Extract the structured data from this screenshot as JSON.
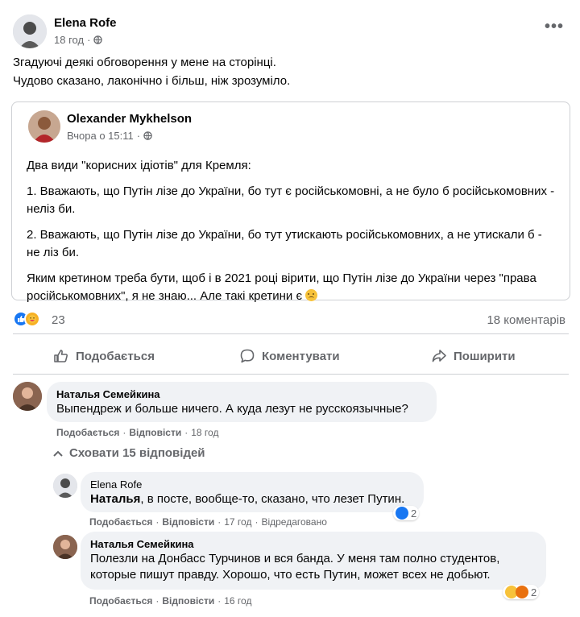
{
  "post": {
    "author": "Elena Rofe",
    "time": "18 год",
    "lines": [
      "Згадуючі деякі обговорення у мене на сторінці.",
      "Чудово сказано, лаконічно і більш, ніж зрозуміло."
    ]
  },
  "shared": {
    "author": "Olexander Mykhelson",
    "time": "Вчора о 15:11",
    "paragraphs": [
      "Два види \"корисних ідіотів\" для Кремля:",
      "1. Вважають, що Путін лізе до України, бо тут є російськомовні, а не було б російськомовних - неліз би.",
      "2. Вважають, що Путін лізе до України, бо тут утискають російськомовних, а не утискали б - не ліз би.",
      "Яким кретином треба бути, щоб і в 2021 році вірити, що Путін лізе до України через \"права російськомовних\", я не знаю... Але такі кретини є"
    ]
  },
  "stats": {
    "reactions": "23",
    "comments": "18 коментарів"
  },
  "actions": {
    "like": "Подобається",
    "comment": "Коментувати",
    "share": "Поширити"
  },
  "comments": [
    {
      "author": "Наталья Семейкина",
      "text": "Выпендреж и больше ничего. А куда лезут не русскоязычные?",
      "like": "Подобається",
      "reply": "Відповісти",
      "time": "18 год"
    },
    {
      "author": "Elena Rofe",
      "mention": "Наталья",
      "text": ", в посте, вообще-то, сказано, что лезет Путин.",
      "like": "Подобається",
      "reply": "Відповісти",
      "time": "17 год",
      "edited": "Відредаговано",
      "reactions": "2"
    },
    {
      "author": "Наталья Семейкина",
      "line1": "Полезли на Донбасс Турчинов и вся банда. У меня там полно студентов,",
      "line2": "которые пишут правду. Хорошо, что есть Путин, может всех не добьют.",
      "like": "Подобається",
      "reply": "Відповісти",
      "time": "16 год",
      "reactions": "2"
    }
  ],
  "hide_replies": "Сховати 15 відповідей",
  "colors": {
    "accent": "#1877f2",
    "muted": "#65676b",
    "bubble": "#f0f2f5"
  }
}
